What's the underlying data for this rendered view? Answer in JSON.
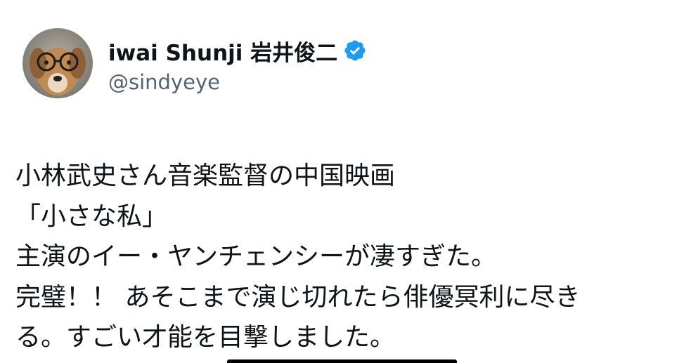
{
  "profile": {
    "display_name": "iwai Shunji 岩井俊二",
    "handle": "@sindyeye",
    "verified": true,
    "verified_color": "#1d9bf0"
  },
  "tweet": {
    "lines": [
      "小林武史さん音楽監督の中国映画",
      "「小さな私」",
      "主演のイー・ヤンチェンシーが凄すぎた。",
      "完璧！！ あそこまで演じ切れたら俳優冥利に尽き",
      "る。すごい才能を目撃しました。"
    ]
  },
  "icons": {
    "avatar": "dog-with-glasses-avatar",
    "verified": "verified-badge-icon"
  }
}
